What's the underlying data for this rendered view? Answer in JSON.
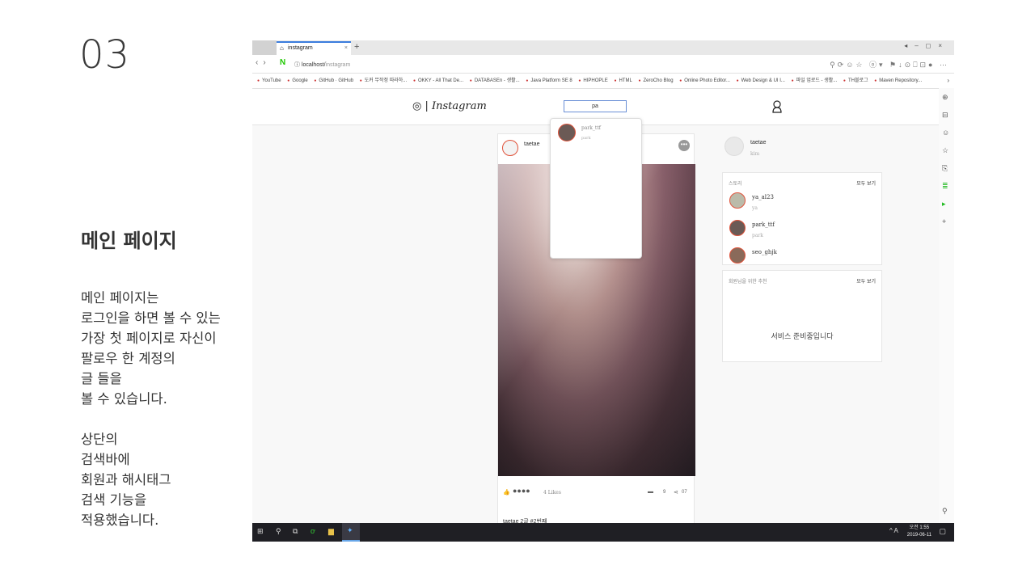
{
  "slide": {
    "number": "03",
    "title": "메인 페이지",
    "description": "메인 페이지는\n로그인을 하면 볼 수 있는\n가장 첫 페이지로 자신이\n팔로우 한 계정의\n글 들을\n볼 수 있습니다.\n\n상단의\n검색바에\n회원과 해시태그\n검색 기능을\n적용했습니다."
  },
  "browser": {
    "tab_title": "instagram",
    "url_host": "localhost",
    "url_path": "instagram",
    "bookmarks": [
      "YouTube",
      "Google",
      "GitHub · GitHub",
      "도커 무작정 따라하...",
      "OKKY - All That De...",
      "DATABASEn - 생활...",
      "Java Platform SE 8",
      "HIPHOPLE",
      "HTML",
      "ZeroCho Blog",
      "Online Photo Editor...",
      "Web Design & UI I...",
      "파일 업로드 - 생활...",
      "TH블로그",
      "Maven Repository..."
    ]
  },
  "instagram": {
    "logo_text": "Instagram",
    "search_value": "pa",
    "search_result": {
      "name": "park_ttf",
      "sub": "park"
    },
    "post": {
      "author": "taetae",
      "likes": "4 Likes",
      "comments": "9",
      "shares": "07",
      "caption": "taetae 2글 #2번째"
    },
    "profile": {
      "name": "taetae",
      "sub": "kim"
    },
    "stories_panel": {
      "title": "스토리",
      "more": "모두 보기",
      "items": [
        {
          "name": "ya_al23",
          "sub": "ya"
        },
        {
          "name": "park_ttf",
          "sub": "park"
        },
        {
          "name": "seo_ghjk",
          "sub": ""
        }
      ]
    },
    "recommend_panel": {
      "title": "회원님을 위한 추천",
      "more": "모두 보기",
      "message": "서비스 준비중입니다"
    }
  },
  "taskbar": {
    "time": "오전 1:55",
    "date": "2019-06-11",
    "lang": "A"
  }
}
